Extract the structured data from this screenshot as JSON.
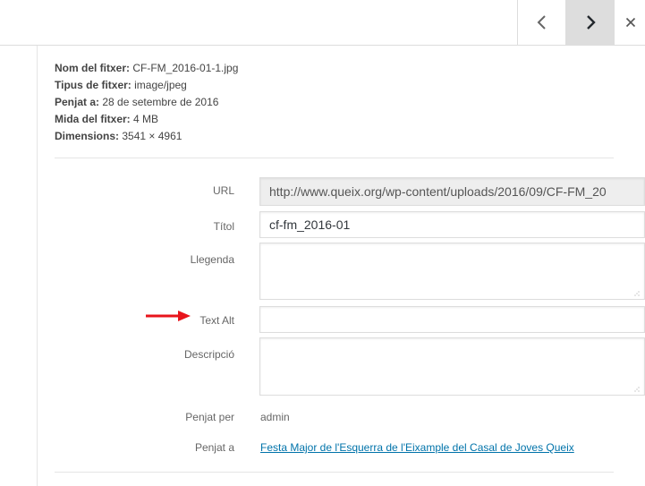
{
  "header": {
    "prev_icon": "chevron-left-icon",
    "next_icon": "chevron-right-icon",
    "close_icon": "close-icon"
  },
  "details": {
    "filename_label": "Nom del fitxer:",
    "filename_value": "CF-FM_2016-01-1.jpg",
    "filetype_label": "Tipus de fitxer:",
    "filetype_value": "image/jpeg",
    "uploaded_label": "Penjat a:",
    "uploaded_value": "28 de setembre de 2016",
    "filesize_label": "Mida del fitxer:",
    "filesize_value": "4 MB",
    "dimensions_label": "Dimensions:",
    "dimensions_value": "3541 × 4961"
  },
  "form": {
    "url_label": "URL",
    "url_value": "http://www.queix.org/wp-content/uploads/2016/09/CF-FM_20",
    "title_label": "Títol",
    "title_value": "cf-fm_2016-01",
    "caption_label": "Llegenda",
    "caption_value": "",
    "alt_label": "Text Alt",
    "alt_value": "",
    "description_label": "Descripció",
    "description_value": "",
    "uploaded_by_label": "Penjat per",
    "uploaded_by_value": "admin",
    "uploaded_to_label": "Penjat a",
    "uploaded_to_value": "Festa Major de l'Esquerra de l'Eixample del Casal de Joves Queix"
  },
  "colors": {
    "arrow": "#e8141b",
    "link": "#0073aa",
    "active_nav": "#dddddd"
  }
}
